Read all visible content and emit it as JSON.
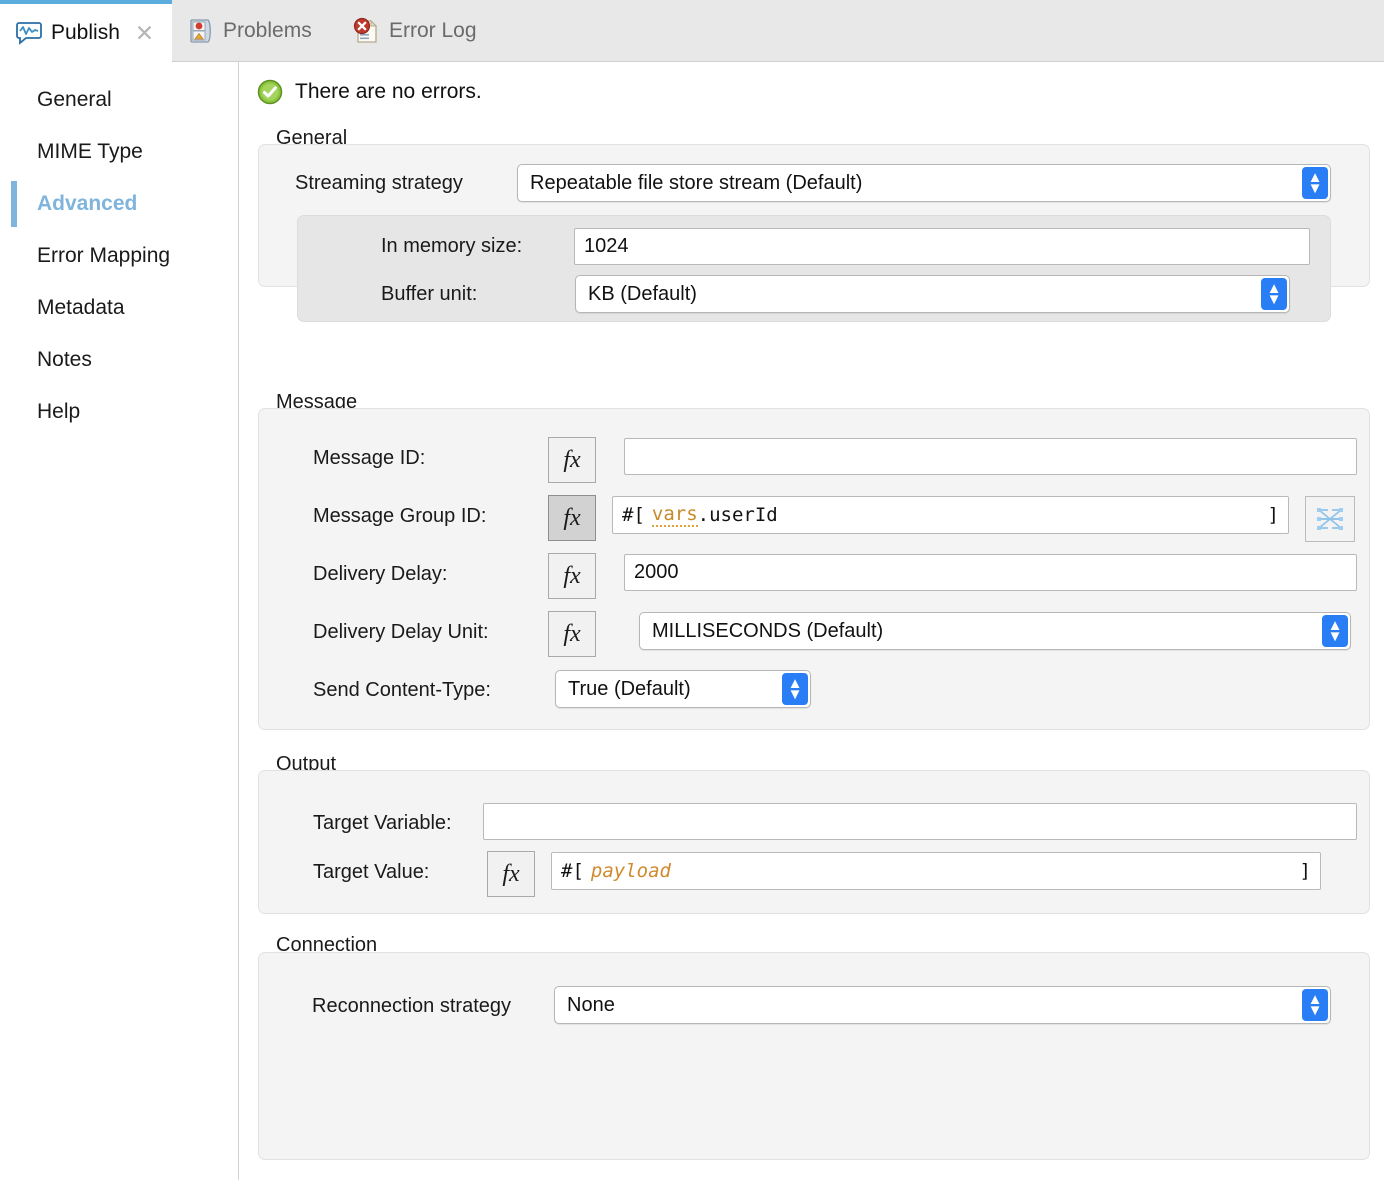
{
  "tabs": [
    {
      "label": "Publish",
      "icon": "publish-bubble-icon",
      "active": true,
      "closable": true,
      "close_glyph": "✕"
    },
    {
      "label": "Problems",
      "icon": "problems-icon",
      "active": false,
      "closable": false
    },
    {
      "label": "Error Log",
      "icon": "error-log-icon",
      "active": false,
      "closable": false
    }
  ],
  "sidebar": {
    "items": [
      {
        "label": "General",
        "selected": false
      },
      {
        "label": "MIME Type",
        "selected": false
      },
      {
        "label": "Advanced",
        "selected": true
      },
      {
        "label": "Error Mapping",
        "selected": false
      },
      {
        "label": "Metadata",
        "selected": false
      },
      {
        "label": "Notes",
        "selected": false
      },
      {
        "label": "Help",
        "selected": false
      }
    ]
  },
  "status": {
    "icon": "success-check-icon",
    "text": "There are no errors."
  },
  "sections": {
    "general": {
      "title": "General",
      "streaming_strategy_label": "Streaming strategy",
      "streaming_strategy_value": "Repeatable file store stream (Default)",
      "in_memory_size_label": "In memory size:",
      "in_memory_size_value": "1024",
      "buffer_unit_label": "Buffer unit:",
      "buffer_unit_value": "KB (Default)"
    },
    "message": {
      "title": "Message",
      "message_id_label": "Message ID:",
      "message_id_value": "",
      "message_group_id_label": "Message Group ID:",
      "message_group_id_prefix": "#[",
      "message_group_id_var": "vars",
      "message_group_id_rest": ".userId",
      "message_group_id_suffix": "]",
      "delivery_delay_label": "Delivery Delay:",
      "delivery_delay_value": "2000",
      "delivery_delay_unit_label": "Delivery Delay Unit:",
      "delivery_delay_unit_value": "MILLISECONDS (Default)",
      "send_content_type_label": "Send Content-Type:",
      "send_content_type_value": "True (Default)",
      "fx_label": "fx",
      "datasense_icon": "datasense-transform-icon"
    },
    "output": {
      "title": "Output",
      "target_variable_label": "Target Variable:",
      "target_variable_value": "",
      "target_value_label": "Target Value:",
      "target_value_prefix": "#[",
      "target_value_expr": "payload",
      "target_value_suffix": "]"
    },
    "connection": {
      "title": "Connection",
      "reconnection_strategy_label": "Reconnection strategy",
      "reconnection_strategy_value": "None"
    }
  },
  "colors": {
    "accent": "#5badde",
    "selected_text": "#7fb4dc",
    "combo_arrow": "#2a7ef5",
    "expression_var": "#c8892a",
    "expression_payload": "#d08a2e",
    "success_green": "#7ab828"
  },
  "combo_arrow_glyphs": {
    "up": "⌃",
    "down": "⌄"
  }
}
